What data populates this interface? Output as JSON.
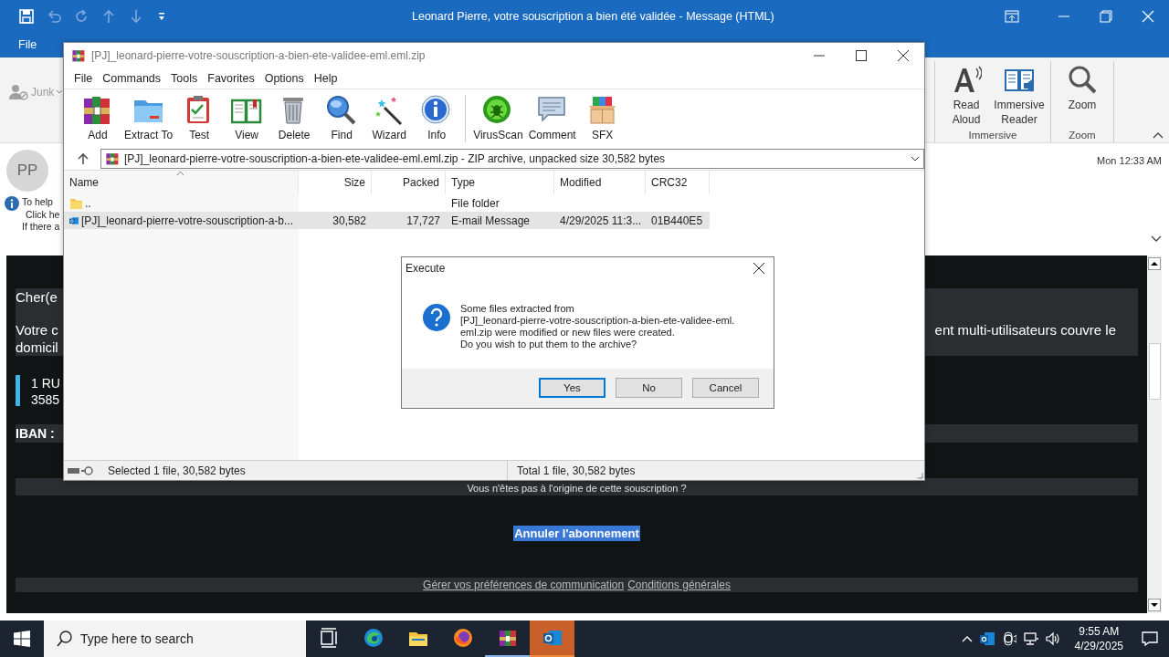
{
  "outlook": {
    "title": "Leonard Pierre, votre souscription a bien été validée  -  Message (HTML)",
    "file_tab": "File",
    "junk": "Junk",
    "ribbon_groups": [
      {
        "label": "Immersive",
        "buttons": [
          {
            "label": "Read Aloud",
            "kind": "read"
          },
          {
            "label": "Immersive Reader",
            "kind": "reader"
          }
        ]
      },
      {
        "label": "Zoom",
        "buttons": [
          {
            "label": "Zoom",
            "kind": "zoom"
          }
        ]
      }
    ],
    "avatar": "PP",
    "date": "Mon 12:33 AM",
    "info_lines": [
      "To help",
      "Click he",
      "If there a"
    ]
  },
  "email": {
    "greeting": "Cher(e",
    "paragraph_left": [
      "Votre c",
      "domicil"
    ],
    "paragraph_right": "ent multi-utilisateurs couvre le",
    "address": [
      "1 RU",
      "3585"
    ],
    "iban": "IBAN :",
    "question": "Vous n'êtes pas à l'origine de cette souscription ?",
    "unsubscribe": {
      "label": "Annuler l'abonnement",
      "highlighted": true
    },
    "footer_links": [
      "Gérer vos préférences de communication",
      "Conditions générales"
    ]
  },
  "winrar": {
    "title": "[PJ]_leonard-pierre-votre-souscription-a-bien-ete-validee-eml.eml.zip",
    "menu": [
      "File",
      "Commands",
      "Tools",
      "Favorites",
      "Options",
      "Help"
    ],
    "toolbar": [
      {
        "label": "Add",
        "kind": "add"
      },
      {
        "label": "Extract To",
        "kind": "extract"
      },
      {
        "label": "Test",
        "kind": "test"
      },
      {
        "label": "View",
        "kind": "view"
      },
      {
        "label": "Delete",
        "kind": "delete"
      },
      {
        "label": "Find",
        "kind": "find"
      },
      {
        "label": "Wizard",
        "kind": "wizard"
      },
      {
        "label": "Info",
        "kind": "info"
      },
      {
        "label": "VirusScan",
        "kind": "virus"
      },
      {
        "label": "Comment",
        "kind": "comment"
      },
      {
        "label": "SFX",
        "kind": "sfx"
      }
    ],
    "address": "[PJ]_leonard-pierre-votre-souscription-a-bien-ete-validee-eml.eml.zip - ZIP archive, unpacked size 30,582 bytes",
    "columns": [
      "Name",
      "Size",
      "Packed",
      "Type",
      "Modified",
      "CRC32"
    ],
    "rows": [
      {
        "kind": "folder",
        "name": "..",
        "type": "File folder",
        "selected": false
      },
      {
        "kind": "email",
        "name": "[PJ]_leonard-pierre-votre-souscription-a-b...",
        "size": "30,582",
        "packed": "17,727",
        "type": "E-mail Message",
        "modified": "4/29/2025 11:3...",
        "crc32": "01B440E5",
        "selected": true
      }
    ],
    "status_left": "Selected 1 file, 30,582 bytes",
    "status_right": "Total 1 file, 30,582 bytes"
  },
  "dialog": {
    "title": "Execute",
    "message_lines": [
      "Some files extracted from",
      "[PJ]_leonard-pierre-votre-souscription-a-bien-ete-validee-eml.",
      "eml.zip were modified or new files were created.",
      "Do you wish to put them to the archive?"
    ],
    "buttons": [
      {
        "label": "Yes",
        "default": true
      },
      {
        "label": "No",
        "default": false
      },
      {
        "label": "Cancel",
        "default": false
      }
    ]
  },
  "taskbar": {
    "search_placeholder": "Type here to search",
    "apps": [
      {
        "kind": "taskview",
        "running": false,
        "flashing": false
      },
      {
        "kind": "edge",
        "running": false,
        "flashing": false
      },
      {
        "kind": "explorer",
        "running": false,
        "flashing": false
      },
      {
        "kind": "firefox",
        "running": false,
        "flashing": false
      },
      {
        "kind": "winrar",
        "running": true,
        "flashing": false
      },
      {
        "kind": "outlook",
        "running": true,
        "flashing": true
      }
    ],
    "time": "9:55 AM",
    "date": "4/29/2025"
  }
}
